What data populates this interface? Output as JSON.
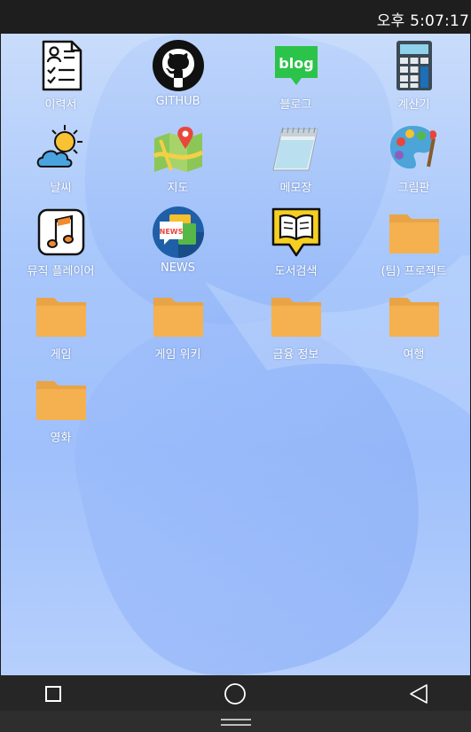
{
  "status_bar": {
    "time": "오후 5:07:17"
  },
  "apps": [
    {
      "label": "이력서",
      "icon": "resume-icon"
    },
    {
      "label": "GITHUB",
      "icon": "github-icon"
    },
    {
      "label": "블로그",
      "icon": "blog-icon"
    },
    {
      "label": "계산기",
      "icon": "calculator-icon"
    },
    {
      "label": "날씨",
      "icon": "weather-icon"
    },
    {
      "label": "지도",
      "icon": "map-icon"
    },
    {
      "label": "메모장",
      "icon": "notepad-icon"
    },
    {
      "label": "그림판",
      "icon": "paint-palette-icon"
    },
    {
      "label": "뮤직 플레이어",
      "icon": "music-note-icon"
    },
    {
      "label": "NEWS",
      "icon": "news-icon"
    },
    {
      "label": "도서검색",
      "icon": "book-icon"
    },
    {
      "label": "(팀) 프로젝트",
      "icon": "folder-icon"
    },
    {
      "label": "게임",
      "icon": "folder-icon"
    },
    {
      "label": "게임 위키",
      "icon": "folder-icon"
    },
    {
      "label": "금융 정보",
      "icon": "folder-icon"
    },
    {
      "label": "여행",
      "icon": "folder-icon"
    },
    {
      "label": "영화",
      "icon": "folder-icon"
    }
  ],
  "nav_bar": {
    "buttons": [
      "square-icon",
      "circle-icon",
      "triangle-back-icon"
    ]
  },
  "colors": {
    "folder": "#f5b04f",
    "folder_tab": "#e9a447",
    "blog_green": "#2bc34a",
    "desktop": "#a8c7fb"
  }
}
